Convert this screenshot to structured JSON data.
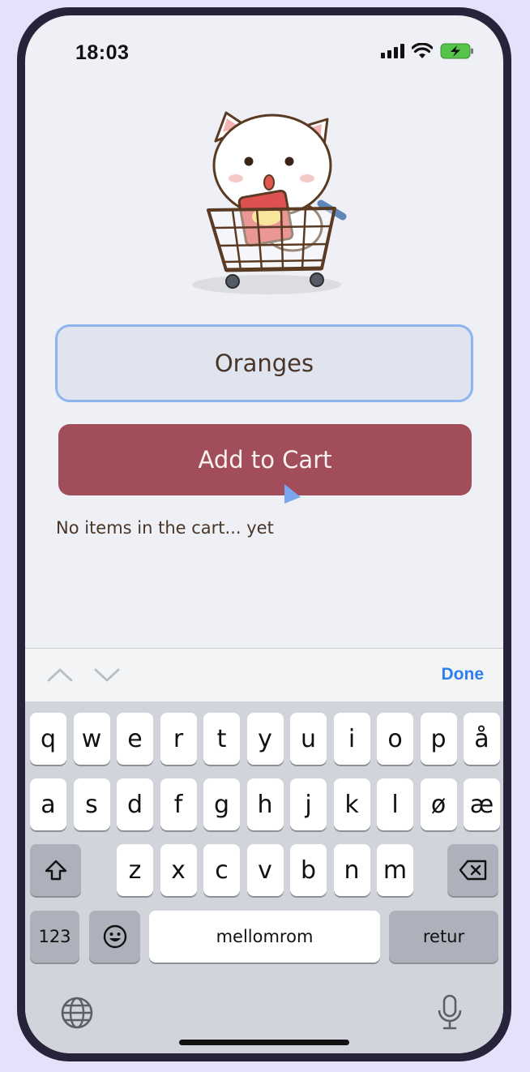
{
  "status": {
    "time": "18:03"
  },
  "form": {
    "item_value": "Oranges",
    "add_label": "Add to Cart",
    "empty_message": "No items in the cart... yet"
  },
  "toolbar": {
    "done_label": "Done"
  },
  "keyboard": {
    "row1": [
      "q",
      "w",
      "e",
      "r",
      "t",
      "y",
      "u",
      "i",
      "o",
      "p",
      "å"
    ],
    "row2": [
      "a",
      "s",
      "d",
      "f",
      "g",
      "h",
      "j",
      "k",
      "l",
      "ø",
      "æ"
    ],
    "row3": [
      "z",
      "x",
      "c",
      "v",
      "b",
      "n",
      "m"
    ],
    "numbers_label": "123",
    "space_label": "mellomrom",
    "return_label": "retur"
  },
  "colors": {
    "accent": "#a14e5a",
    "input_border": "#8fb4ee",
    "done": "#2f7ef0",
    "background": "#e4e2fb"
  },
  "icons": {
    "battery": "battery-charging-icon",
    "wifi": "wifi-icon",
    "signal": "signal-icon",
    "shift": "shift-icon",
    "delete": "delete-icon",
    "emoji": "emoji-icon",
    "globe": "globe-icon",
    "mic": "microphone-icon"
  }
}
